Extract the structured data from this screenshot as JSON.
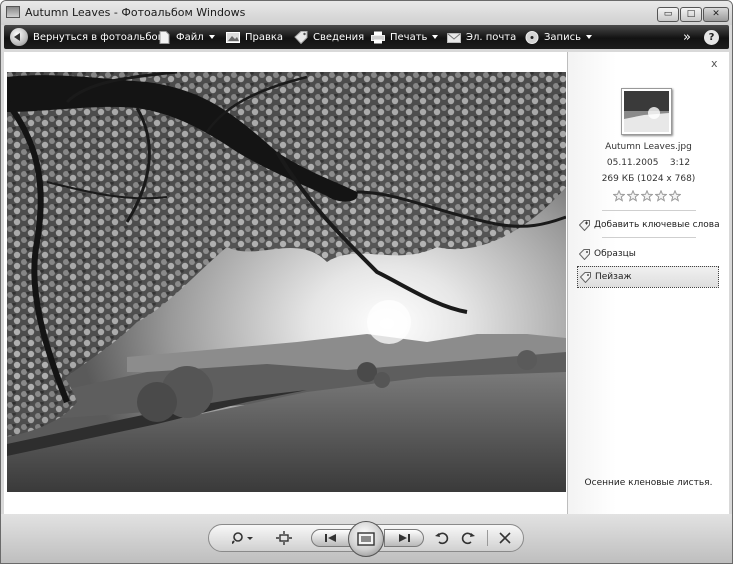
{
  "window": {
    "title": "Autumn Leaves - Фотоальбом Windows",
    "controls": {
      "minimize": "▭",
      "maximize": "□",
      "close": "✕"
    }
  },
  "toolbar": {
    "back": "Вернуться в фотоальбом",
    "file": "Файл",
    "fix": "Правка",
    "info": "Сведения",
    "print": "Печать",
    "email": "Эл. почта",
    "burn": "Запись",
    "more": "»",
    "help": "?"
  },
  "info_pane": {
    "close": "x",
    "file_name": "Autumn Leaves.jpg",
    "date": "05.11.2005",
    "time": "3:12",
    "size": "269 КБ (1024 x 768)",
    "rating": {
      "value": 0,
      "max": 5
    },
    "add_tags": "Добавить ключевые слова",
    "tags": [
      "Образцы",
      "Пейзаж"
    ],
    "caption": "Осенние кленовые листья."
  },
  "colors": {
    "toolbar_dark": "#1e1e1e",
    "selected_tag_bg": "#e4e4e4"
  },
  "icons": {
    "back": "back-arrow-icon",
    "file": "document-icon",
    "fix": "image-edit-icon",
    "info": "tag-info-icon",
    "print": "printer-icon",
    "email": "envelope-icon",
    "burn": "disc-icon",
    "zoom": "magnifier-icon",
    "fit": "actual-size-icon",
    "previous": "previous-icon",
    "slideshow": "slideshow-icon",
    "next": "next-icon",
    "rotate_ccw": "rotate-left-icon",
    "rotate_cw": "rotate-right-icon",
    "delete": "delete-icon"
  }
}
